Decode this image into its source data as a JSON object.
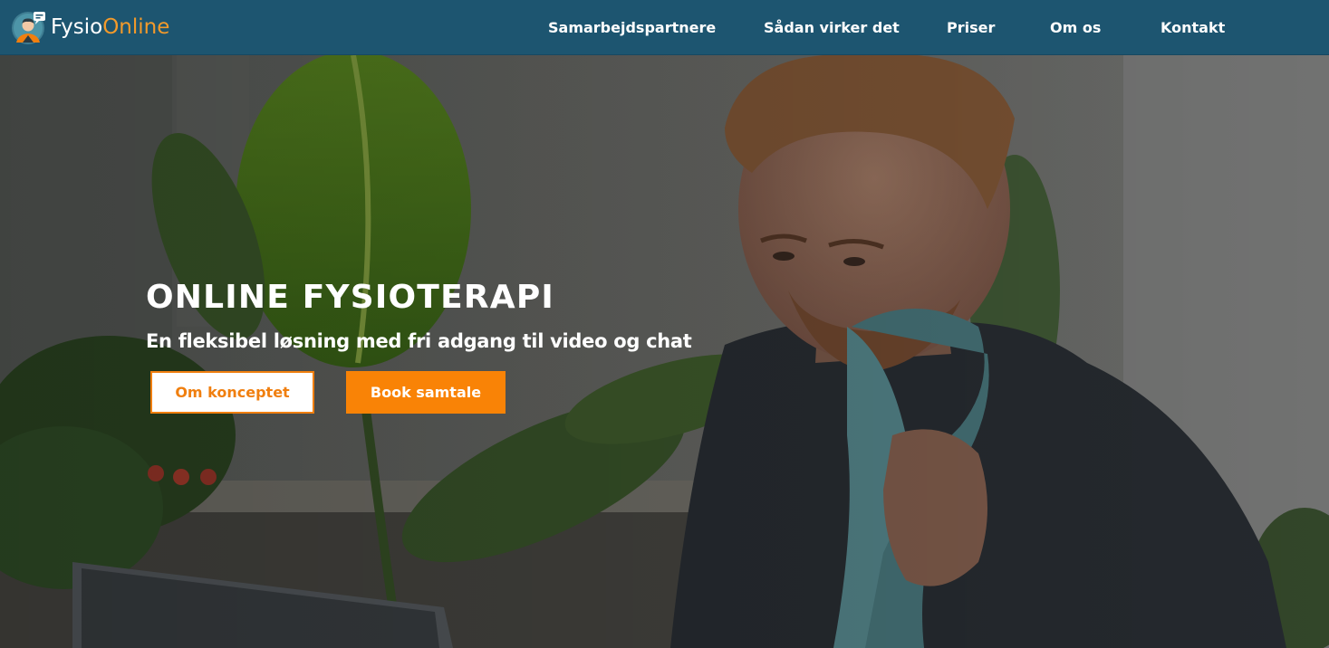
{
  "brand": {
    "name_part1": "Fysio",
    "name_part2": "Online",
    "logo_icon": "physio-person-with-chat-bubble",
    "colors": {
      "nav_bg": "#1d5570",
      "accent": "#f39a2a",
      "button": "#f98306"
    }
  },
  "nav": {
    "items": [
      {
        "label": "Samarbejdspartnere"
      },
      {
        "label": "Sådan virker det"
      },
      {
        "label": "Priser"
      },
      {
        "label": "Om os"
      },
      {
        "label": "Kontakt"
      }
    ]
  },
  "hero": {
    "title": "ONLINE FYSIOTERAPI",
    "subtitle": "En fleksibel løsning med fri adgang til video og chat",
    "primary_button": "Om konceptet",
    "secondary_button": "Book samtale",
    "background_image": "man-with-ice-pack-at-laptop-photo"
  }
}
